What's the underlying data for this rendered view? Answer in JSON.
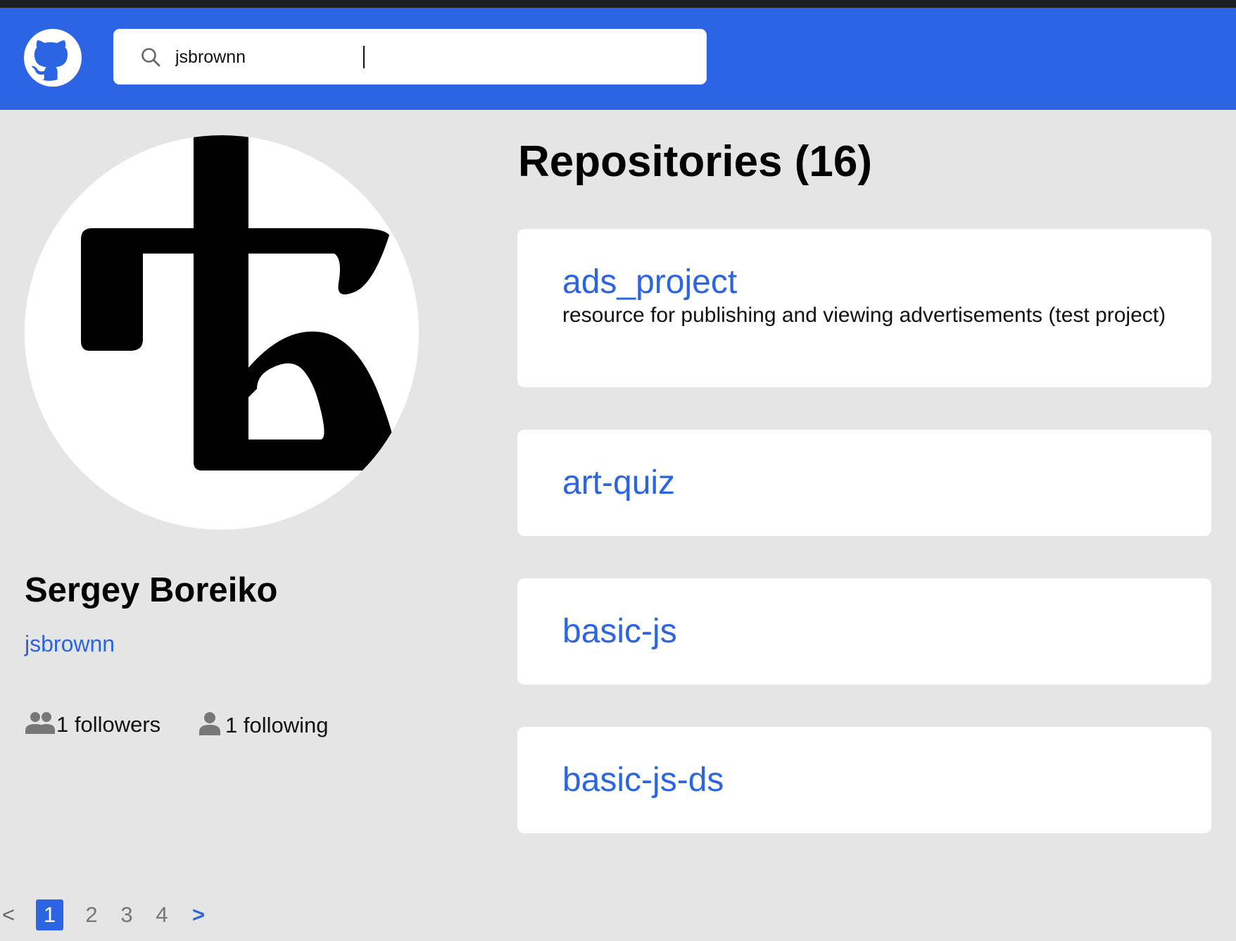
{
  "colors": {
    "accent": "#2b65e3",
    "background": "#e5e5e5",
    "card": "#ffffff"
  },
  "header": {
    "logo_icon": "github-octocat-icon",
    "search": {
      "icon": "search-icon",
      "value": "jsbrownn"
    }
  },
  "profile": {
    "name": "Sergey Boreiko",
    "login": "jsbrownn",
    "followers": {
      "icon": "people-icon",
      "label": "1 followers"
    },
    "following": {
      "icon": "person-icon",
      "label": "1 following"
    }
  },
  "repositories": {
    "title": "Repositories (16)",
    "items": [
      {
        "name": "ads_project",
        "description": "resource for publishing and viewing advertisements (test project)"
      },
      {
        "name": "art-quiz",
        "description": ""
      },
      {
        "name": "basic-js",
        "description": ""
      },
      {
        "name": "basic-js-ds",
        "description": ""
      }
    ]
  },
  "pagination": {
    "prev": "<",
    "pages": [
      "1",
      "2",
      "3",
      "4"
    ],
    "current": "1",
    "next": ">"
  }
}
